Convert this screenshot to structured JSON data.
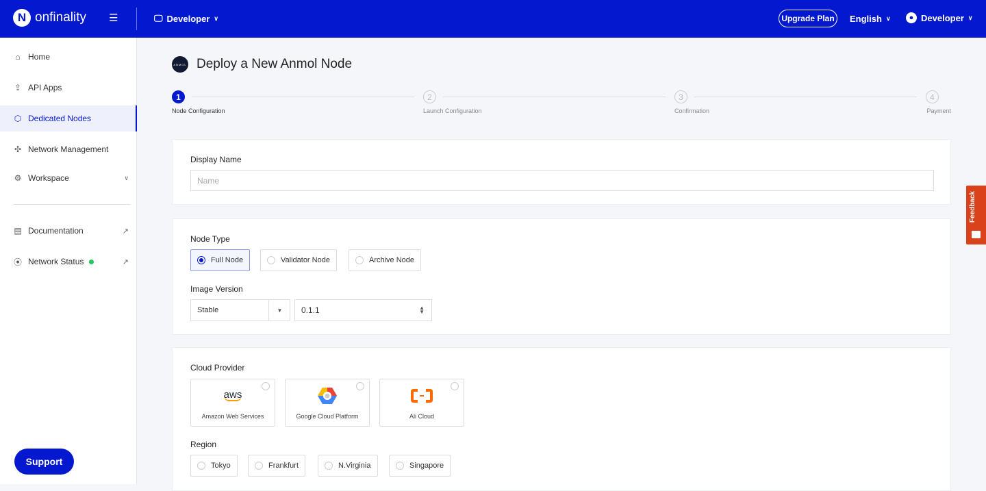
{
  "header": {
    "brand": "onfinality",
    "workspace": "Developer",
    "upgrade": "Upgrade Plan",
    "language": "English",
    "user": "Developer"
  },
  "sidebar": {
    "items": [
      {
        "label": "Home"
      },
      {
        "label": "API Apps"
      },
      {
        "label": "Dedicated Nodes"
      },
      {
        "label": "Network Management"
      },
      {
        "label": "Workspace"
      },
      {
        "label": "Documentation"
      },
      {
        "label": "Network Status"
      }
    ],
    "support": "Support",
    "status_color": "#22c55e"
  },
  "page": {
    "title": "Deploy a New Anmol Node",
    "avatar_text": "ANMOL"
  },
  "steps": [
    {
      "num": "1",
      "label": "Node Configuration"
    },
    {
      "num": "2",
      "label": "Launch Configuration"
    },
    {
      "num": "3",
      "label": "Confirmation"
    },
    {
      "num": "4",
      "label": "Payment"
    }
  ],
  "form": {
    "display_name": {
      "label": "Display Name",
      "placeholder": "Name",
      "value": ""
    },
    "node_type": {
      "label": "Node Type",
      "options": [
        "Full Node",
        "Validator Node",
        "Archive Node"
      ],
      "selected": "Full Node"
    },
    "image_version": {
      "label": "Image Version",
      "channel": "Stable",
      "version": "0.1.1"
    },
    "cloud_provider": {
      "label": "Cloud Provider",
      "options": [
        "Amazon Web Services",
        "Google Cloud Platform",
        "Ali Cloud"
      ],
      "aws_logo": "aws"
    },
    "region": {
      "label": "Region",
      "options": [
        "Tokyo",
        "Frankfurt",
        "N.Virginia",
        "Singapore"
      ]
    }
  },
  "feedback": "Feedback",
  "colors": {
    "brand": "#0419cf",
    "feedback": "#d9421b"
  }
}
